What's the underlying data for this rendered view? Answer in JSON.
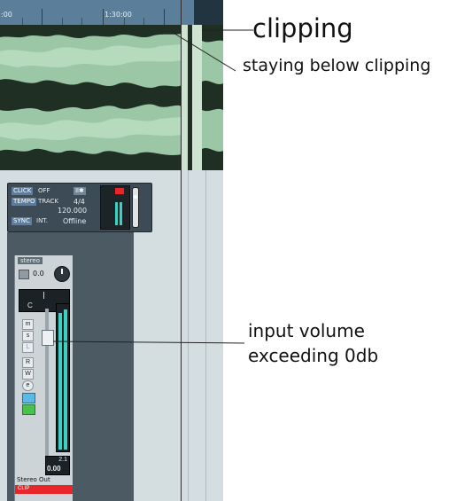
{
  "ruler": {
    "label_left": ":00",
    "label_mid": "1:30:00"
  },
  "annotations": {
    "clipping": "clipping",
    "staying_below": "staying below clipping",
    "input_volume_line1": "input volume",
    "input_volume_line2": "exceeding 0db"
  },
  "transport": {
    "click_label": "CLICK",
    "click_value": "OFF",
    "tempo_label": "TEMPO",
    "tempo_mode": "TRACK",
    "signature": "4/4",
    "tempo_value": "120.000",
    "sync_label": "SYNC",
    "sync_mode": "INT.",
    "sync_status": "Offline"
  },
  "channel": {
    "name": "stereo",
    "pan_value": "0.0",
    "pan_display": "C",
    "buttons": {
      "mute": "m",
      "solo": "s",
      "listen": "L",
      "read": "R",
      "write": "W",
      "edit": "e"
    },
    "peak_value": "2.1",
    "volume_value": "0.00",
    "output_name": "Stereo Out",
    "clip_label": "CLIP"
  },
  "colors": {
    "waveform_fill": "#9cc7a6",
    "waveform_dark": "#1f2f24",
    "meter": "#3fd0c0",
    "clip": "#e8262a"
  }
}
